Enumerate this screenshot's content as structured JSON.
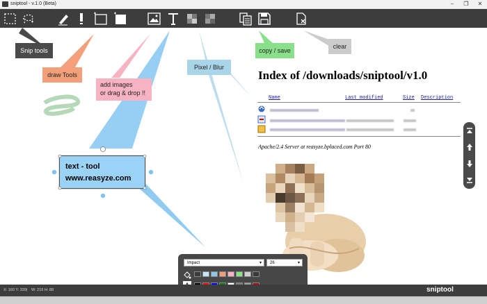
{
  "window": {
    "title": "sniptool - v.1.0 (Beta)",
    "controls": [
      "–",
      "❐",
      "✕"
    ]
  },
  "toolbar": {
    "tools": [
      "rect-select",
      "lasso-select",
      "pen",
      "marker",
      "rectangle-outline",
      "rectangle-filled",
      "image",
      "text",
      "pixelate",
      "blur",
      "copy",
      "save",
      "clear"
    ]
  },
  "callouts": {
    "snip_tools": "Snip tools",
    "draw_tools": "draw Tools",
    "add_images": [
      "add images",
      "or drag & drop !!"
    ],
    "pixel_blur": "Pixel / Blur",
    "copy_save": "copy / save",
    "clear": "clear"
  },
  "text_tool_box": {
    "line1": "text - tool",
    "line2": "www.reasyze.com"
  },
  "listing": {
    "heading": "Index of /downloads/sniptool/v1.0",
    "columns": [
      "Name",
      "Last modified",
      "Size",
      "Description"
    ],
    "footer": "Apache/2.4 Server at reasyze.bplaced.com Port 80"
  },
  "font_panel": {
    "font_name": "Impact",
    "font_size": "26",
    "swatches_row1": [
      "#3a3a3a",
      "#c8e4f7",
      "#8fc6ee",
      "#f3a07a",
      "#f8b3c2",
      "#8fe08a",
      "#cfcfcf",
      "#3a3a3a"
    ],
    "swatches_row2": [
      "#000000",
      "#ff0000",
      "#0000ff",
      "#008000",
      "#ffffff",
      "#808080",
      "#a0a0a0",
      "#c00000"
    ]
  },
  "status": {
    "coords": "X: 160 Y: 339",
    "separator": "|",
    "size": "W: 219 H: 88"
  },
  "brand": "sniptool"
}
